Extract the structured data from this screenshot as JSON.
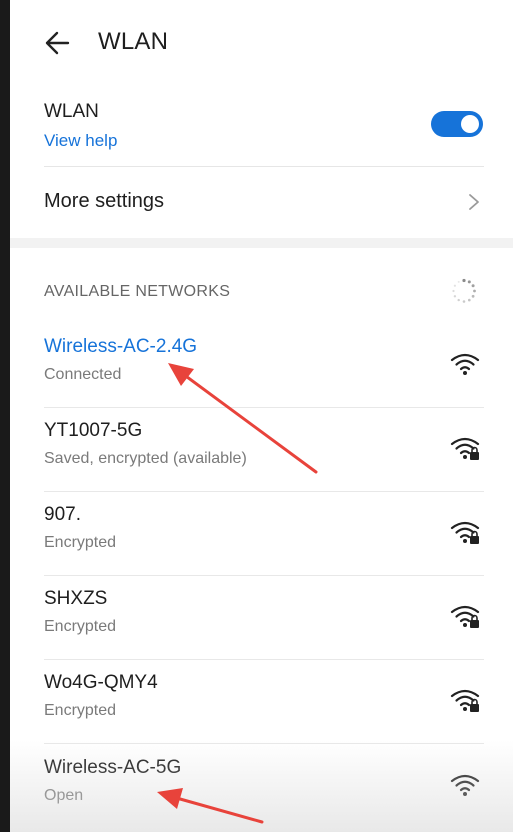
{
  "header": {
    "title": "WLAN",
    "back_icon": "arrow-left-icon"
  },
  "wlan": {
    "label": "WLAN",
    "help_link": "View help",
    "toggle_on": true
  },
  "more_settings": {
    "label": "More settings",
    "chevron_icon": "chevron-right-icon"
  },
  "available": {
    "header": "AVAILABLE NETWORKS",
    "spinner_icon": "loading-spinner-icon"
  },
  "networks": [
    {
      "name": "Wireless-AC-2.4G",
      "status": "Connected",
      "connected": true,
      "secured": false
    },
    {
      "name": "YT1007-5G",
      "status": "Saved, encrypted (available)",
      "connected": false,
      "secured": true
    },
    {
      "name": "907.",
      "status": "Encrypted",
      "connected": false,
      "secured": true
    },
    {
      "name": "SHXZS",
      "status": "Encrypted",
      "connected": false,
      "secured": true
    },
    {
      "name": "Wo4G-QMY4",
      "status": "Encrypted",
      "connected": false,
      "secured": true
    },
    {
      "name": "Wireless-AC-5G",
      "status": "Open",
      "connected": false,
      "secured": false
    }
  ],
  "colors": {
    "accent": "#1673d9",
    "annotation_arrow": "#e8433b"
  }
}
